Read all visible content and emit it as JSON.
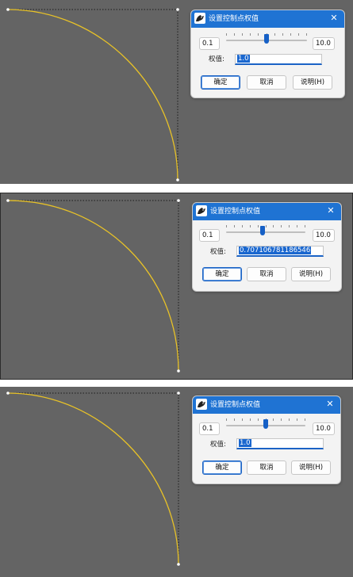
{
  "dialog": {
    "title": "设置控制点权值",
    "close_glyph": "✕",
    "min_value": "0.1",
    "max_value": "10.0",
    "weight_label": "权值:",
    "ok_label": "确定",
    "cancel_label": "取消",
    "help_label": "说明(H)"
  },
  "states": [
    {
      "weight_value": "1.0",
      "slider_fraction": 0.5
    },
    {
      "weight_value": "0.707106781186546",
      "slider_fraction": 0.46
    },
    {
      "weight_value": "1.0",
      "slider_fraction": 0.5
    }
  ],
  "colors": {
    "viewport_bg": "#646464",
    "curve": "#e8c227",
    "control_polygon": "#1a1a1a",
    "accent": "#1f73d3"
  },
  "icons": {
    "app": "rhino-icon",
    "close": "close-icon"
  }
}
